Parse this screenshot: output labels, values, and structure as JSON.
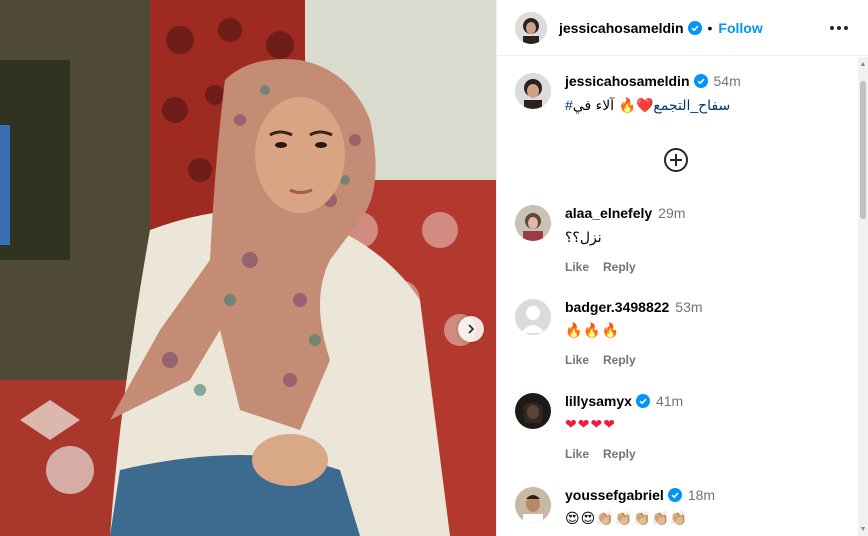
{
  "post": {
    "author": "jessicahosameldin",
    "follow_label": "Follow",
    "dot": "•"
  },
  "caption": {
    "username": "jessicahosameldin",
    "time": "54m",
    "text_prefix": "❤️🔥 آلاء في ",
    "hashtag": "#سفاح_التجمع"
  },
  "comments": [
    {
      "username": "alaa_elnefely",
      "verified": false,
      "time": "29m",
      "text": "نزل؟؟",
      "like": "Like",
      "reply": "Reply"
    },
    {
      "username": "badger.3498822",
      "verified": false,
      "time": "53m",
      "text": "🔥🔥🔥",
      "like": "Like",
      "reply": "Reply"
    },
    {
      "username": "lillysamyx",
      "verified": true,
      "time": "41m",
      "text": "❤❤❤❤",
      "like": "Like",
      "reply": "Reply"
    },
    {
      "username": "youssefgabriel",
      "verified": true,
      "time": "18m",
      "text": "😍😍👏🏼👏🏼👏🏼👏🏼👏🏼",
      "like": "Like",
      "reply": "Reply"
    }
  ],
  "colors": {
    "accent": "#0095f6",
    "verified": "#0095f6",
    "heart": "#ed1c3a"
  },
  "icons": {
    "more": "more-horizontal-icon",
    "add": "add-circle-icon",
    "next": "chevron-right-icon",
    "verified": "verified-badge-icon"
  }
}
